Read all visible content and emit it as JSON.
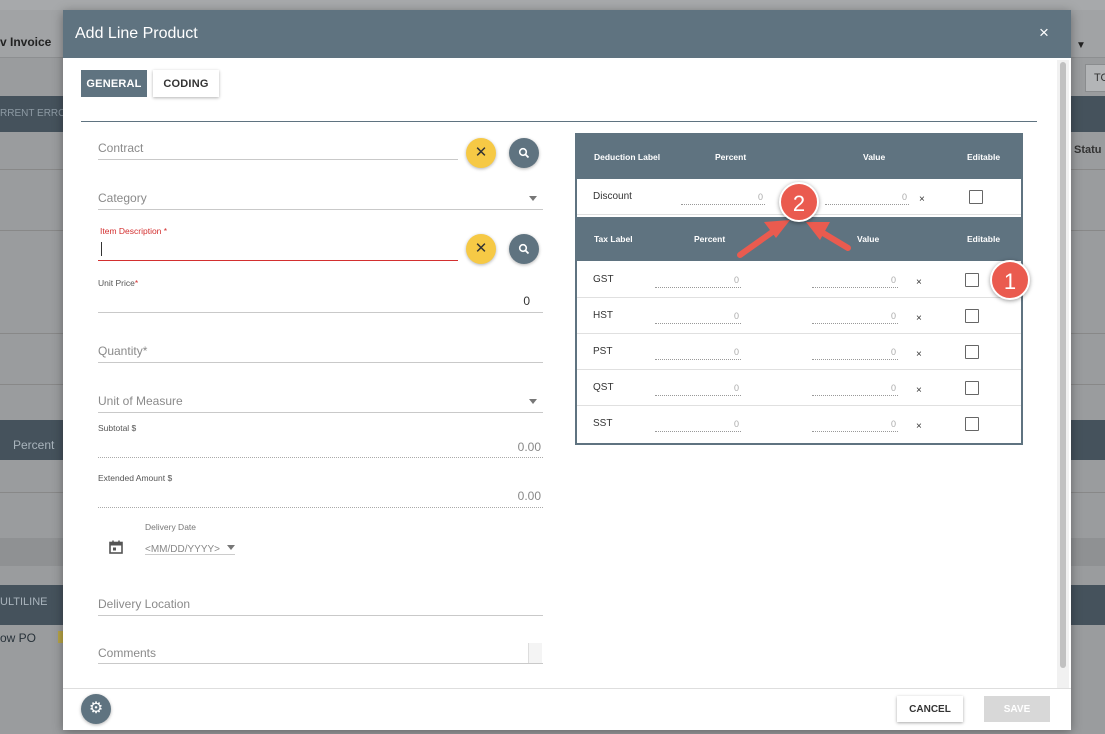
{
  "background": {
    "page_title": "v Invoice",
    "top_button": "TO",
    "header_bar_text": "RRENT ERRO",
    "status_col": "Statu",
    "percent_col": "Percent",
    "multiline_btn": "ULTILINE",
    "show_po_label": "ow PO"
  },
  "modal": {
    "title": "Add Line Product",
    "close_icon": "×",
    "tabs": [
      {
        "label": "GENERAL",
        "active": true
      },
      {
        "label": "CODING",
        "active": false
      }
    ]
  },
  "form": {
    "contract": {
      "placeholder": "Contract"
    },
    "category": {
      "placeholder": "Category"
    },
    "item_description": {
      "label": "Item Description",
      "required_mark": "*"
    },
    "unit_price": {
      "label": "Unit Price",
      "required_mark": "*",
      "value": "0"
    },
    "quantity": {
      "placeholder": "Quantity",
      "required_mark": "*"
    },
    "unit_of_measure": {
      "placeholder": "Unit of Measure"
    },
    "subtotal": {
      "label": "Subtotal $",
      "value": "0.00"
    },
    "extended_amount": {
      "label": "Extended Amount $",
      "value": "0.00"
    },
    "delivery_date": {
      "label": "Delivery Date",
      "placeholder": "<MM/DD/YYYY>"
    },
    "delivery_location": {
      "placeholder": "Delivery Location"
    },
    "comments": {
      "placeholder": "Comments"
    }
  },
  "deductions": {
    "headers": {
      "label": "Deduction Label",
      "percent": "Percent",
      "value": "Value",
      "editable": "Editable"
    },
    "rows": [
      {
        "label": "Discount",
        "percent": "0",
        "value": "0",
        "remove": "×"
      }
    ]
  },
  "taxes": {
    "headers": {
      "label": "Tax Label",
      "percent": "Percent",
      "value": "Value",
      "editable": "Editable"
    },
    "rows": [
      {
        "label": "GST",
        "percent": "0",
        "value": "0",
        "remove": "×"
      },
      {
        "label": "HST",
        "percent": "0",
        "value": "0",
        "remove": "×"
      },
      {
        "label": "PST",
        "percent": "0",
        "value": "0",
        "remove": "×"
      },
      {
        "label": "QST",
        "percent": "0",
        "value": "0",
        "remove": "×"
      },
      {
        "label": "SST",
        "percent": "0",
        "value": "0",
        "remove": "×"
      }
    ]
  },
  "footer": {
    "cancel_label": "CANCEL",
    "save_label": "SAVE"
  },
  "callouts": {
    "one": "1",
    "two": "2"
  },
  "colors": {
    "header": "#5f7380",
    "accent_yellow": "#f6c945",
    "error_red": "#d32f2f",
    "callout_red": "#ea5b4f"
  }
}
